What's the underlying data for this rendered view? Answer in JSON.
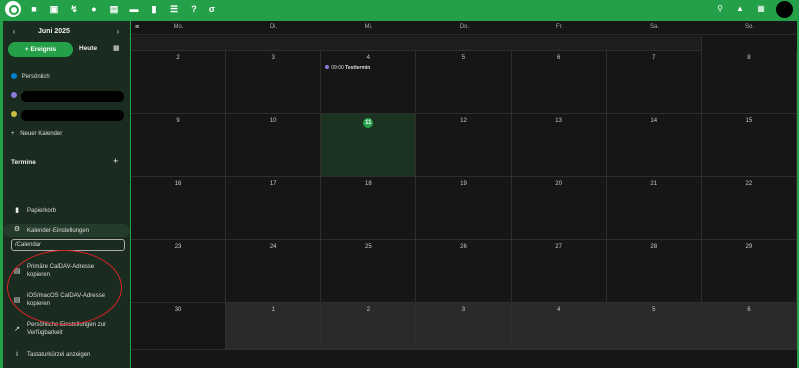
{
  "topbar": {
    "apps": [
      "folder-icon",
      "image-icon",
      "activity-icon",
      "contacts-icon",
      "calendar-icon",
      "deck-icon",
      "stats-icon",
      "list-icon",
      "help-icon",
      "flow-icon"
    ],
    "right_icons": [
      "search-icon",
      "bell-icon",
      "contacts-menu-icon"
    ]
  },
  "sidebar": {
    "month_label": "Juni 2025",
    "new_event_label": "+ Ereignis",
    "today_label": "Heute",
    "calendars": [
      {
        "label": "Persönlich",
        "color": "#0082c9"
      }
    ],
    "new_calendar_label": "Neuer Kalender",
    "termine_label": "Termine",
    "trash_label": "Papierkorb",
    "settings_label": "Kalender-Einstellungen",
    "caldav_input_value": "/Calendar",
    "copy_primary_label": "Primäre CalDAV-Adresse kopieren",
    "copy_ios_label": "iOS/macOS CalDAV-Adresse kopieren",
    "availability_label": "Persönliche Einstellungen zur Verfügbarkeit",
    "shortcuts_label": "Tastaturkürzel anzeigen"
  },
  "calendar": {
    "weekdays": [
      "Mo.",
      "Di.",
      "Mi.",
      "Do.",
      "Fr.",
      "Sa.",
      "So."
    ],
    "weeks": [
      [
        "2",
        "3",
        "4",
        "5",
        "6",
        "7",
        "8"
      ],
      [
        "9",
        "10",
        "11",
        "12",
        "13",
        "14",
        "15"
      ],
      [
        "16",
        "17",
        "18",
        "19",
        "20",
        "21",
        "22"
      ],
      [
        "23",
        "24",
        "25",
        "26",
        "27",
        "28",
        "29"
      ],
      [
        "30",
        "1",
        "2",
        "3",
        "4",
        "5",
        "6"
      ]
    ],
    "event": {
      "time": "09:00",
      "title": "Testtermin"
    },
    "today": "11"
  },
  "colors": {
    "accent": "#24a148",
    "event_dot": "#8a7bd8",
    "highlight_circle": "#d9232a"
  }
}
